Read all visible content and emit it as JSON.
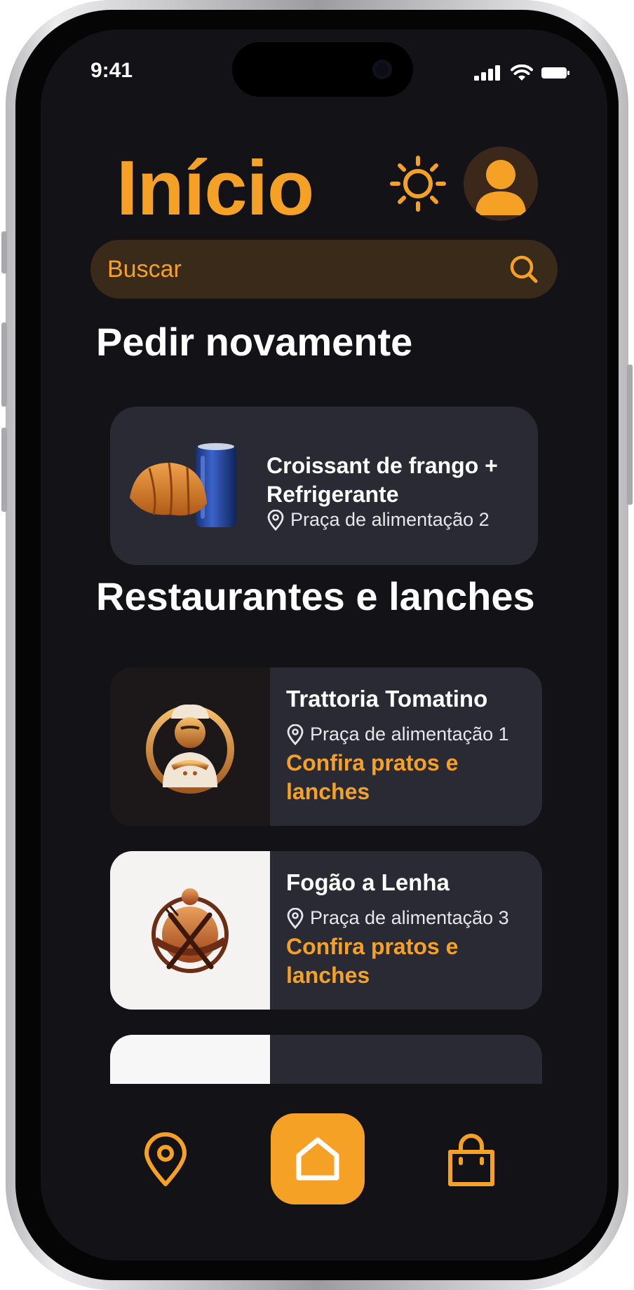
{
  "status_bar": {
    "time": "9:41"
  },
  "header": {
    "title": "Início"
  },
  "search": {
    "placeholder": "Buscar"
  },
  "reorder": {
    "section_title": "Pedir novamente",
    "item": {
      "name": "Croissant de frango + Refrigerante",
      "location": "Praça de alimentação 2"
    }
  },
  "restaurants": {
    "section_title": "Restaurantes e lanches",
    "items": [
      {
        "name": "Trattoria Tomatino",
        "location": "Praça de alimentação 1",
        "cta": "Confira pratos e lanches"
      },
      {
        "name": "Fogão a Lenha",
        "location": "Praça de alimentação 3",
        "cta": "Confira pratos e lanches"
      }
    ]
  },
  "bottom_nav": {
    "items": [
      "map-pin-icon",
      "home-icon",
      "shopping-bag-icon"
    ],
    "active": "home-icon"
  },
  "colors": {
    "accent": "#f4a125",
    "background": "#131317",
    "card": "#2a2a35",
    "search_bg": "#3a2a1a"
  }
}
